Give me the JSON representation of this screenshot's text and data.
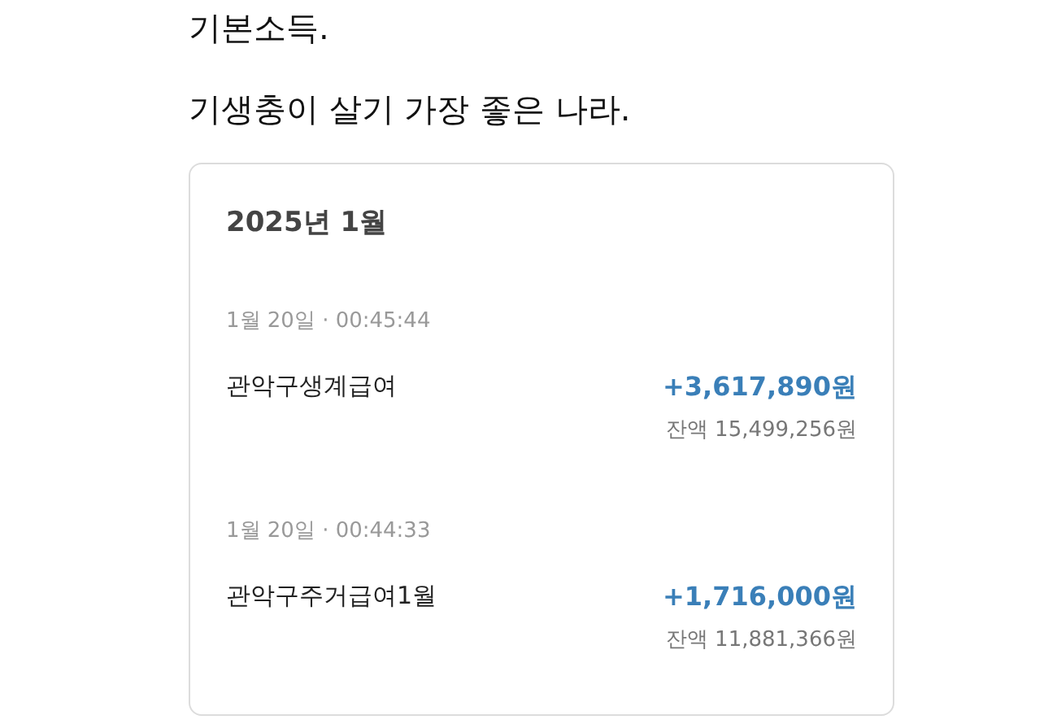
{
  "post_lines": [
    "기본소득.",
    "기생충이 살기 가장 좋은 나라."
  ],
  "card": {
    "month": "2025년 1월",
    "transactions": [
      {
        "datetime": "1월 20일 · 00:45:44",
        "name": "관악구생계급여",
        "amount": "+3,617,890원",
        "balance": "잔액 15,499,256원"
      },
      {
        "datetime": "1월 20일 · 00:44:33",
        "name": "관악구주거급여1월",
        "amount": "+1,716,000원",
        "balance": "잔액 11,881,366원"
      }
    ]
  }
}
